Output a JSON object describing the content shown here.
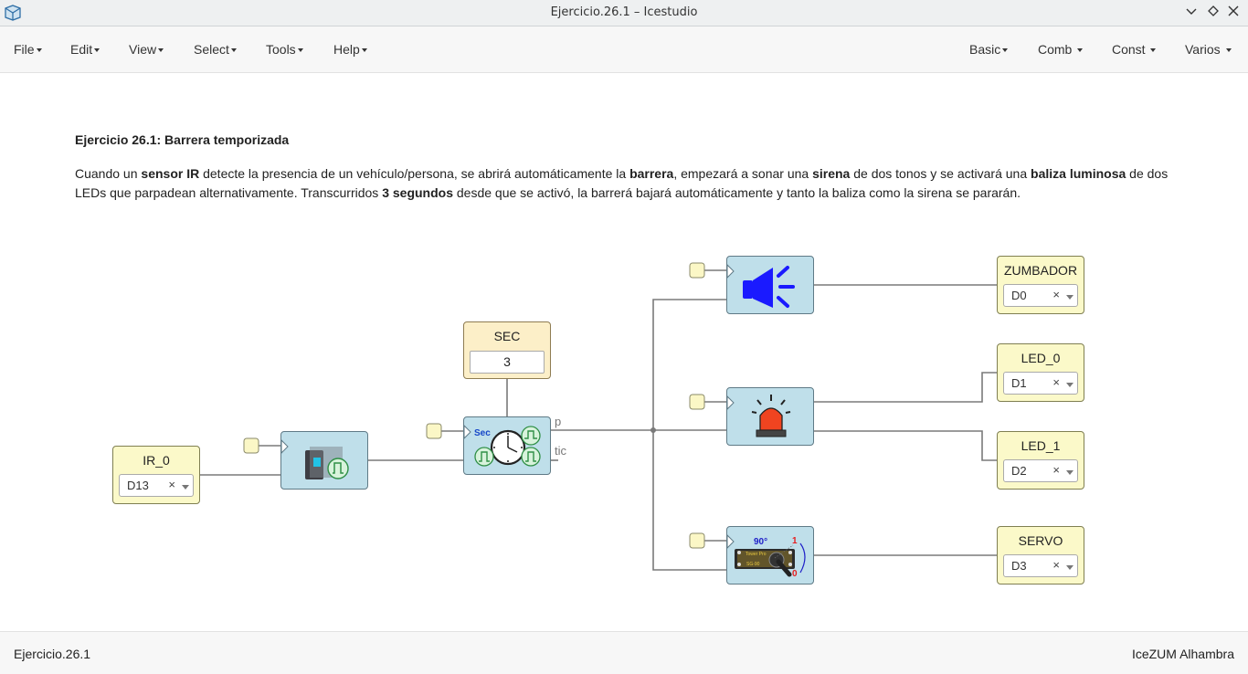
{
  "window": {
    "title": "Ejercicio.26.1 – Icestudio"
  },
  "menubar": {
    "left": [
      "File",
      "Edit",
      "View",
      "Select",
      "Tools",
      "Help"
    ],
    "right": [
      "Basic",
      "Comb",
      "Const",
      "Varios"
    ]
  },
  "content": {
    "heading": "Ejercicio 26.1: Barrera temporizada",
    "desc": [
      {
        "t": "Cuando un ",
        "b": false
      },
      {
        "t": "sensor IR",
        "b": true
      },
      {
        "t": " detecte la presencia de un vehículo/persona, se abrirá automáticamente la ",
        "b": false
      },
      {
        "t": "barrera",
        "b": true
      },
      {
        "t": ", empezará a sonar una ",
        "b": false
      },
      {
        "t": "sirena",
        "b": true
      },
      {
        "t": " de dos tonos y se activará una ",
        "b": false
      },
      {
        "t": "baliza luminosa",
        "b": true
      },
      {
        "t": " de dos LEDs que parpadean alternativamente. Transcurridos ",
        "b": false
      },
      {
        "t": "3 segundos",
        "b": true
      },
      {
        "t": " desde que se activó, la barrerá bajará automáticamente y tanto la baliza como la sirena se pararán.",
        "b": false
      }
    ]
  },
  "blocks": {
    "ir": {
      "label": "IR_0",
      "pin": "D13"
    },
    "sec": {
      "label": "SEC",
      "value": "3"
    },
    "timer_ports": {
      "p": "p",
      "tic": "tic",
      "sec_text": "Sec"
    },
    "zumbador": {
      "label": "ZUMBADOR",
      "pin": "D0"
    },
    "led0": {
      "label": "LED_0",
      "pin": "D1"
    },
    "led1": {
      "label": "LED_1",
      "pin": "D2"
    },
    "servo": {
      "label": "SERVO",
      "pin": "D3"
    },
    "servo_icon": {
      "deg": "90°",
      "one": "1",
      "zero": "0",
      "brand": "Tower Pro",
      "model": "SG-90"
    },
    "clear_symbol": "×"
  },
  "status": {
    "left": "Ejercicio.26.1",
    "right": "IceZUM Alhambra"
  },
  "colors": {
    "io_block": "#fbf9c9",
    "const_block": "#fcefc8",
    "module_block": "#bfdfea",
    "wire": "#777777"
  }
}
